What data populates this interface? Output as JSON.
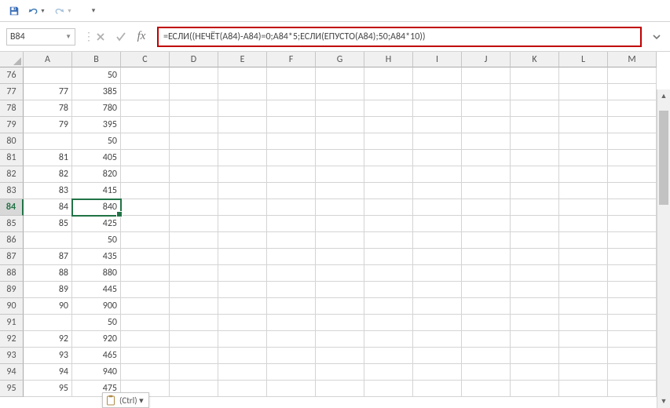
{
  "quick_access": {
    "customize_glyph": "▾"
  },
  "name_box": {
    "value": "B84"
  },
  "formula": {
    "value": "=ЕСЛИ((НЕЧЁТ(A84)-A84)=0;A84*5;ЕСЛИ(ЕПУСТО(A84);50;A84*10))"
  },
  "fx_label": "fx",
  "columns": [
    "A",
    "B",
    "C",
    "D",
    "E",
    "F",
    "G",
    "H",
    "I",
    "J",
    "K",
    "L",
    "M"
  ],
  "rows": [
    {
      "num": "76",
      "cells": [
        "",
        "50"
      ]
    },
    {
      "num": "77",
      "cells": [
        "77",
        "385"
      ]
    },
    {
      "num": "78",
      "cells": [
        "78",
        "780"
      ]
    },
    {
      "num": "79",
      "cells": [
        "79",
        "395"
      ]
    },
    {
      "num": "80",
      "cells": [
        "",
        "50"
      ]
    },
    {
      "num": "81",
      "cells": [
        "81",
        "405"
      ]
    },
    {
      "num": "82",
      "cells": [
        "82",
        "820"
      ]
    },
    {
      "num": "83",
      "cells": [
        "83",
        "415"
      ]
    },
    {
      "num": "84",
      "cells": [
        "84",
        "840"
      ],
      "active": true,
      "sel_col": 1
    },
    {
      "num": "85",
      "cells": [
        "85",
        "425"
      ]
    },
    {
      "num": "86",
      "cells": [
        "",
        "50"
      ]
    },
    {
      "num": "87",
      "cells": [
        "87",
        "435"
      ]
    },
    {
      "num": "88",
      "cells": [
        "88",
        "880"
      ]
    },
    {
      "num": "89",
      "cells": [
        "89",
        "445"
      ]
    },
    {
      "num": "90",
      "cells": [
        "90",
        "900"
      ]
    },
    {
      "num": "91",
      "cells": [
        "",
        "50"
      ]
    },
    {
      "num": "92",
      "cells": [
        "92",
        "920"
      ]
    },
    {
      "num": "93",
      "cells": [
        "93",
        "465"
      ]
    },
    {
      "num": "94",
      "cells": [
        "94",
        "940"
      ]
    },
    {
      "num": "95",
      "cells": [
        "95",
        "475"
      ]
    }
  ],
  "paste_options": {
    "label": "(Ctrl) ▾"
  }
}
